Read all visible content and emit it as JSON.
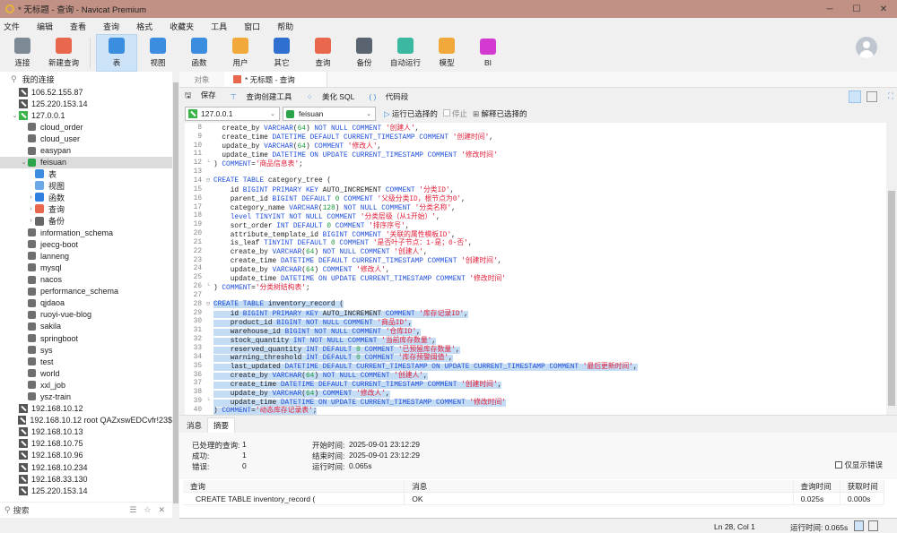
{
  "window": {
    "title": "* 无标题 - 查询 - Navicat Premium",
    "min": "─",
    "max": "☐",
    "close": "✕"
  },
  "menu": [
    "文件",
    "编辑",
    "查看",
    "查询",
    "格式",
    "收藏夹",
    "工具",
    "窗口",
    "帮助"
  ],
  "toolbar": [
    {
      "label": "连接",
      "icon": "connect-icon",
      "color": "#7d8a96"
    },
    {
      "label": "新建查询",
      "icon": "new-query-icon",
      "color": "#e9674c"
    },
    {
      "label": "表",
      "icon": "table-icon",
      "color": "#3b8de0",
      "active": true
    },
    {
      "label": "视图",
      "icon": "view-icon",
      "color": "#3b8de0"
    },
    {
      "label": "函数",
      "icon": "function-icon",
      "color": "#3b8de0"
    },
    {
      "label": "用户",
      "icon": "user-icon",
      "color": "#f2a93b"
    },
    {
      "label": "其它",
      "icon": "other-icon",
      "color": "#2f6fd0"
    },
    {
      "label": "查询",
      "icon": "query-icon",
      "color": "#e9674c"
    },
    {
      "label": "备份",
      "icon": "backup-icon",
      "color": "#5a6470"
    },
    {
      "label": "自动运行",
      "icon": "robot-icon",
      "color": "#3bb8a0"
    },
    {
      "label": "模型",
      "icon": "model-icon",
      "color": "#f2a93b"
    },
    {
      "label": "BI",
      "icon": "bi-icon",
      "color": "#d33bd0"
    }
  ],
  "sidebar": {
    "root": "我的连接",
    "items": [
      {
        "label": "106.52.155.87",
        "type": "conn",
        "level": 1
      },
      {
        "label": "125.220.153.14",
        "type": "conn",
        "level": 1
      },
      {
        "label": "127.0.0.1",
        "type": "conn-open",
        "level": 1,
        "chev": "⌄"
      },
      {
        "label": "cloud_order",
        "type": "db",
        "level": 2
      },
      {
        "label": "cloud_user",
        "type": "db",
        "level": 2
      },
      {
        "label": "easypan",
        "type": "db",
        "level": 2
      },
      {
        "label": "feisuan",
        "type": "db-open",
        "level": 2,
        "chev": "⌄",
        "selected": true
      },
      {
        "label": "表",
        "type": "obj",
        "color": "#3b8de0",
        "level": 3
      },
      {
        "label": "视图",
        "type": "obj",
        "color": "#6aa8e8",
        "level": 3
      },
      {
        "label": "函数",
        "type": "obj",
        "color": "#2f7fe0",
        "level": 3,
        "chev": "›"
      },
      {
        "label": "查询",
        "type": "obj",
        "color": "#e9674c",
        "level": 3,
        "chev": "›"
      },
      {
        "label": "备份",
        "type": "obj",
        "color": "#666",
        "level": 3,
        "chev": "›"
      },
      {
        "label": "information_schema",
        "type": "db",
        "level": 2
      },
      {
        "label": "jeecg-boot",
        "type": "db",
        "level": 2
      },
      {
        "label": "lanneng",
        "type": "db",
        "level": 2
      },
      {
        "label": "mysql",
        "type": "db",
        "level": 2
      },
      {
        "label": "nacos",
        "type": "db",
        "level": 2
      },
      {
        "label": "performance_schema",
        "type": "db",
        "level": 2
      },
      {
        "label": "qjdaoa",
        "type": "db",
        "level": 2
      },
      {
        "label": "ruoyi-vue-blog",
        "type": "db",
        "level": 2
      },
      {
        "label": "sakila",
        "type": "db",
        "level": 2
      },
      {
        "label": "springboot",
        "type": "db",
        "level": 2
      },
      {
        "label": "sys",
        "type": "db",
        "level": 2
      },
      {
        "label": "test",
        "type": "db",
        "level": 2
      },
      {
        "label": "world",
        "type": "db",
        "level": 2
      },
      {
        "label": "xxl_job",
        "type": "db",
        "level": 2
      },
      {
        "label": "ysz-train",
        "type": "db",
        "level": 2
      },
      {
        "label": "192.168.10.12",
        "type": "conn",
        "level": 1
      },
      {
        "label": "192.168.10.12 root QAZxswEDCvfr!23$",
        "type": "conn",
        "level": 1
      },
      {
        "label": "192.168.10.13",
        "type": "conn",
        "level": 1
      },
      {
        "label": "192.168.10.75",
        "type": "conn",
        "level": 1
      },
      {
        "label": "192.168.10.96",
        "type": "conn",
        "level": 1
      },
      {
        "label": "192.168.10.234",
        "type": "conn",
        "level": 1
      },
      {
        "label": "192.168.33.130",
        "type": "conn",
        "level": 1
      },
      {
        "label": "125.220.153.14",
        "type": "conn",
        "level": 1
      }
    ],
    "search_placeholder": "搜索"
  },
  "tabs": {
    "objects": "对象",
    "query": "* 无标题 - 查询"
  },
  "query_toolbar": {
    "save": "保存",
    "builder": "查询创建工具",
    "beautify": "美化 SQL",
    "snippet": "代码段"
  },
  "conn_bar": {
    "connection": "127.0.0.1",
    "database": "feisuan",
    "run": "运行已选择的",
    "stop": "停止",
    "explain": "解释已选择的"
  },
  "editor": {
    "lines": [
      {
        "no": 8,
        "t": [
          [
            "p",
            "  create_by "
          ],
          [
            "k",
            "VARCHAR"
          ],
          [
            "p",
            "("
          ],
          [
            "n",
            "64"
          ],
          [
            "p",
            ") "
          ],
          [
            "k",
            "NOT NULL COMMENT "
          ],
          [
            "s",
            "'创建人'"
          ],
          [
            "p",
            ","
          ]
        ]
      },
      {
        "no": 9,
        "t": [
          [
            "p",
            "  create_time "
          ],
          [
            "k",
            "DATETIME DEFAULT CURRENT_TIMESTAMP COMMENT "
          ],
          [
            "s",
            "'创建时间'"
          ],
          [
            "p",
            ","
          ]
        ]
      },
      {
        "no": 10,
        "t": [
          [
            "p",
            "  update_by "
          ],
          [
            "k",
            "VARCHAR"
          ],
          [
            "p",
            "("
          ],
          [
            "n",
            "64"
          ],
          [
            "p",
            ") "
          ],
          [
            "k",
            "COMMENT "
          ],
          [
            "s",
            "'修改人'"
          ],
          [
            "p",
            ","
          ]
        ]
      },
      {
        "no": 11,
        "t": [
          [
            "p",
            "  update_time "
          ],
          [
            "k",
            "DATETIME ON UPDATE CURRENT_TIMESTAMP COMMENT "
          ],
          [
            "s",
            "'修改时间'"
          ]
        ]
      },
      {
        "no": 12,
        "fold": "└",
        "t": [
          [
            "p",
            ") "
          ],
          [
            "k",
            "COMMENT"
          ],
          [
            "p",
            "="
          ],
          [
            "s",
            "'商品信息表'"
          ],
          [
            "p",
            ";"
          ]
        ]
      },
      {
        "no": 13,
        "t": []
      },
      {
        "no": 14,
        "fold": "⊟",
        "t": [
          [
            "k",
            "CREATE TABLE "
          ],
          [
            "p",
            "category_tree ("
          ]
        ]
      },
      {
        "no": 15,
        "t": [
          [
            "p",
            "    id "
          ],
          [
            "k",
            "BIGINT PRIMARY KEY "
          ],
          [
            "p",
            "AUTO_INCREMENT "
          ],
          [
            "k",
            "COMMENT "
          ],
          [
            "s",
            "'分类ID'"
          ],
          [
            "p",
            ","
          ]
        ]
      },
      {
        "no": 16,
        "t": [
          [
            "p",
            "    parent_id "
          ],
          [
            "k",
            "BIGINT DEFAULT "
          ],
          [
            "n",
            "0"
          ],
          [
            "k",
            " COMMENT "
          ],
          [
            "s",
            "'父级分类ID，根节点为0'"
          ],
          [
            "p",
            ","
          ]
        ]
      },
      {
        "no": 17,
        "t": [
          [
            "p",
            "    category_name "
          ],
          [
            "k",
            "VARCHAR"
          ],
          [
            "p",
            "("
          ],
          [
            "n",
            "128"
          ],
          [
            "p",
            ") "
          ],
          [
            "k",
            "NOT NULL COMMENT "
          ],
          [
            "s",
            "'分类名称'"
          ],
          [
            "p",
            ","
          ]
        ]
      },
      {
        "no": 18,
        "t": [
          [
            "k",
            "    level TINYINT NOT NULL COMMENT "
          ],
          [
            "s",
            "'分类层级（从1开始）'"
          ],
          [
            "p",
            ","
          ]
        ]
      },
      {
        "no": 19,
        "t": [
          [
            "p",
            "    sort_order "
          ],
          [
            "k",
            "INT DEFAULT "
          ],
          [
            "n",
            "0"
          ],
          [
            "k",
            " COMMENT "
          ],
          [
            "s",
            "'排序序号'"
          ],
          [
            "p",
            ","
          ]
        ]
      },
      {
        "no": 20,
        "t": [
          [
            "p",
            "    attribute_template_id "
          ],
          [
            "k",
            "BIGINT COMMENT "
          ],
          [
            "s",
            "'关联的属性模板ID'"
          ],
          [
            "p",
            ","
          ]
        ]
      },
      {
        "no": 21,
        "t": [
          [
            "p",
            "    is_leaf "
          ],
          [
            "k",
            "TINYINT DEFAULT "
          ],
          [
            "n",
            "0"
          ],
          [
            "k",
            " COMMENT "
          ],
          [
            "s",
            "'是否叶子节点：1-是；0-否'"
          ],
          [
            "p",
            ","
          ]
        ]
      },
      {
        "no": 22,
        "t": [
          [
            "p",
            "    create_by "
          ],
          [
            "k",
            "VARCHAR"
          ],
          [
            "p",
            "("
          ],
          [
            "n",
            "64"
          ],
          [
            "p",
            ") "
          ],
          [
            "k",
            "NOT NULL COMMENT "
          ],
          [
            "s",
            "'创建人'"
          ],
          [
            "p",
            ","
          ]
        ]
      },
      {
        "no": 23,
        "t": [
          [
            "p",
            "    create_time "
          ],
          [
            "k",
            "DATETIME DEFAULT CURRENT_TIMESTAMP COMMENT "
          ],
          [
            "s",
            "'创建时间'"
          ],
          [
            "p",
            ","
          ]
        ]
      },
      {
        "no": 24,
        "t": [
          [
            "p",
            "    update_by "
          ],
          [
            "k",
            "VARCHAR"
          ],
          [
            "p",
            "("
          ],
          [
            "n",
            "64"
          ],
          [
            "p",
            ") "
          ],
          [
            "k",
            "COMMENT "
          ],
          [
            "s",
            "'修改人'"
          ],
          [
            "p",
            ","
          ]
        ]
      },
      {
        "no": 25,
        "t": [
          [
            "p",
            "    update_time "
          ],
          [
            "k",
            "DATETIME ON UPDATE CURRENT_TIMESTAMP COMMENT "
          ],
          [
            "s",
            "'修改时间'"
          ]
        ]
      },
      {
        "no": 26,
        "fold": "└",
        "t": [
          [
            "p",
            ") "
          ],
          [
            "k",
            "COMMENT"
          ],
          [
            "p",
            "="
          ],
          [
            "s",
            "'分类树结构表'"
          ],
          [
            "p",
            ";"
          ]
        ]
      },
      {
        "no": 27,
        "t": []
      },
      {
        "no": 28,
        "fold": "⊟",
        "hl": true,
        "t": [
          [
            "k",
            "CREATE TABLE "
          ],
          [
            "p",
            "inventory_record ("
          ]
        ]
      },
      {
        "no": 29,
        "hl": true,
        "t": [
          [
            "p",
            "    id "
          ],
          [
            "k",
            "BIGINT PRIMARY KEY "
          ],
          [
            "p",
            "AUTO_INCREMENT "
          ],
          [
            "k",
            "COMMENT "
          ],
          [
            "s",
            "'库存记录ID'"
          ],
          [
            "p",
            ","
          ]
        ]
      },
      {
        "no": 30,
        "hl": true,
        "t": [
          [
            "p",
            "    product_id "
          ],
          [
            "k",
            "BIGINT NOT NULL COMMENT "
          ],
          [
            "s",
            "'商品ID'"
          ],
          [
            "p",
            ","
          ]
        ]
      },
      {
        "no": 31,
        "hl": true,
        "t": [
          [
            "p",
            "    warehouse_id "
          ],
          [
            "k",
            "BIGINT NOT NULL COMMENT "
          ],
          [
            "s",
            "'仓库ID'"
          ],
          [
            "p",
            ","
          ]
        ]
      },
      {
        "no": 32,
        "hl": true,
        "t": [
          [
            "p",
            "    stock_quantity "
          ],
          [
            "k",
            "INT NOT NULL COMMENT "
          ],
          [
            "s",
            "'当前库存数量'"
          ],
          [
            "p",
            ","
          ]
        ]
      },
      {
        "no": 33,
        "hl": true,
        "t": [
          [
            "p",
            "    reserved_quantity "
          ],
          [
            "k",
            "INT DEFAULT "
          ],
          [
            "n",
            "0"
          ],
          [
            "k",
            " COMMENT "
          ],
          [
            "s",
            "'已预留库存数量'"
          ],
          [
            "p",
            ","
          ]
        ]
      },
      {
        "no": 34,
        "hl": true,
        "t": [
          [
            "p",
            "    warning_threshold "
          ],
          [
            "k",
            "INT DEFAULT "
          ],
          [
            "n",
            "0"
          ],
          [
            "k",
            " COMMENT "
          ],
          [
            "s",
            "'库存预警阈值'"
          ],
          [
            "p",
            ","
          ]
        ]
      },
      {
        "no": 35,
        "hl": true,
        "t": [
          [
            "p",
            "    last_updated "
          ],
          [
            "k",
            "DATETIME DEFAULT CURRENT_TIMESTAMP ON UPDATE CURRENT_TIMESTAMP COMMENT "
          ],
          [
            "s",
            "'最后更新时间'"
          ],
          [
            "p",
            ","
          ]
        ]
      },
      {
        "no": 36,
        "hl": true,
        "t": [
          [
            "p",
            "    create_by "
          ],
          [
            "k",
            "VARCHAR"
          ],
          [
            "p",
            "("
          ],
          [
            "n",
            "64"
          ],
          [
            "p",
            ") "
          ],
          [
            "k",
            "NOT NULL COMMENT "
          ],
          [
            "s",
            "'创建人'"
          ],
          [
            "p",
            ","
          ]
        ]
      },
      {
        "no": 37,
        "hl": true,
        "t": [
          [
            "p",
            "    create_time "
          ],
          [
            "k",
            "DATETIME DEFAULT CURRENT_TIMESTAMP COMMENT "
          ],
          [
            "s",
            "'创建时间'"
          ],
          [
            "p",
            ","
          ]
        ]
      },
      {
        "no": 38,
        "hl": true,
        "t": [
          [
            "p",
            "    update_by "
          ],
          [
            "k",
            "VARCHAR"
          ],
          [
            "p",
            "("
          ],
          [
            "n",
            "64"
          ],
          [
            "p",
            ") "
          ],
          [
            "k",
            "COMMENT "
          ],
          [
            "s",
            "'修改人'"
          ],
          [
            "p",
            ","
          ]
        ]
      },
      {
        "no": 39,
        "hl": true,
        "fold": "└",
        "t": [
          [
            "p",
            "    update_time "
          ],
          [
            "k",
            "DATETIME ON UPDATE CURRENT_TIMESTAMP COMMENT "
          ],
          [
            "s",
            "'修改时间'"
          ]
        ]
      },
      {
        "no": 40,
        "hl": true,
        "t": [
          [
            "p",
            ") "
          ],
          [
            "k",
            "COMMENT"
          ],
          [
            "p",
            "="
          ],
          [
            "s",
            "'动态库存记录表'"
          ],
          [
            "p",
            ";"
          ]
        ]
      }
    ]
  },
  "results": {
    "tabs": [
      "消息",
      "摘要"
    ],
    "summary": {
      "processed_label": "已处理的查询:",
      "processed": "1",
      "success_label": "成功:",
      "success": "1",
      "error_label": "错误:",
      "error": "0",
      "start_label": "开始时间:",
      "start": "2025-09-01 23:12:29",
      "end_label": "结束时间:",
      "end": "2025-09-01 23:12:29",
      "run_label": "运行时间:",
      "run": "0.065s"
    },
    "only_errors": "仅显示错误",
    "columns": [
      "查询",
      "消息",
      "查询时间",
      "获取时间"
    ],
    "rows": [
      [
        "CREATE TABLE inventory_record (",
        "OK",
        "0.025s",
        "0.000s"
      ]
    ]
  },
  "status": {
    "position": "Ln 28, Col 1",
    "runtime": "运行时间: 0.065s"
  }
}
